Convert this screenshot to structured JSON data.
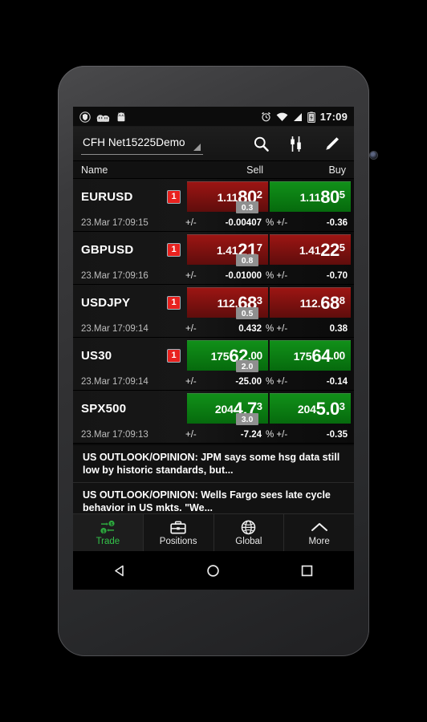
{
  "status_bar": {
    "left_icons": [
      "shield-icon",
      "cloud-sync-icon",
      "android-robot-icon"
    ],
    "right_icons": [
      "alarm-icon",
      "wifi-icon",
      "signal-icon",
      "battery-charging-icon"
    ],
    "time": "17:09"
  },
  "toolbar": {
    "account": "CFH Net15225Demo",
    "actions": [
      {
        "name": "search-icon",
        "label": "Search"
      },
      {
        "name": "chart-icon",
        "label": "Charts"
      },
      {
        "name": "edit-icon",
        "label": "Edit"
      }
    ]
  },
  "quote_header": {
    "name": "Name",
    "sell": "Sell",
    "buy": "Buy"
  },
  "quotes": [
    {
      "symbol": "EURUSD",
      "badge": "1",
      "time": "23.Mar 17:09:15",
      "sell": {
        "pre": "1.11",
        "big": "80",
        "post": "2",
        "post_kind": "sup",
        "color": "red"
      },
      "buy": {
        "pre": "1.11",
        "big": "80",
        "post": "5",
        "post_kind": "sup",
        "color": "green"
      },
      "spread": "0.3",
      "change_label": "+/-",
      "change": "-0.00407",
      "pct_label": "% +/-",
      "pct": "-0.36"
    },
    {
      "symbol": "GBPUSD",
      "badge": "1",
      "time": "23.Mar 17:09:16",
      "sell": {
        "pre": "1.41",
        "big": "21",
        "post": "7",
        "post_kind": "sup",
        "color": "red"
      },
      "buy": {
        "pre": "1.41",
        "big": "22",
        "post": "5",
        "post_kind": "sup",
        "color": "red"
      },
      "spread": "0.8",
      "change_label": "+/-",
      "change": "-0.01000",
      "pct_label": "% +/-",
      "pct": "-0.70"
    },
    {
      "symbol": "USDJPY",
      "badge": "1",
      "time": "23.Mar 17:09:14",
      "sell": {
        "pre": "112.",
        "big": "68",
        "post": "3",
        "post_kind": "sup",
        "color": "red"
      },
      "buy": {
        "pre": "112.",
        "big": "68",
        "post": "8",
        "post_kind": "sup",
        "color": "red"
      },
      "spread": "0.5",
      "change_label": "+/-",
      "change": "0.432",
      "pct_label": "% +/-",
      "pct": "0.38"
    },
    {
      "symbol": "US30",
      "badge": "1",
      "time": "23.Mar 17:09:14",
      "sell": {
        "pre": "175",
        "big": "62",
        "post": ".00",
        "post_kind": "dec",
        "color": "green"
      },
      "buy": {
        "pre": "175",
        "big": "64",
        "post": ".00",
        "post_kind": "dec",
        "color": "green"
      },
      "spread": "2.0",
      "change_label": "+/-",
      "change": "-25.00",
      "pct_label": "% +/-",
      "pct": "-0.14"
    },
    {
      "symbol": "SPX500",
      "badge": "",
      "time": "23.Mar 17:09:13",
      "sell": {
        "pre": "204",
        "big": "4.7",
        "post": "3",
        "post_kind": "sup",
        "color": "green"
      },
      "buy": {
        "pre": "204",
        "big": "5.0",
        "post": "3",
        "post_kind": "sup",
        "color": "green"
      },
      "spread": "3.0",
      "change_label": "+/-",
      "change": "-7.24",
      "pct_label": "% +/-",
      "pct": "-0.35"
    }
  ],
  "news": [
    "US OUTLOOK/OPINION: JPM says some hsg data still low by historic standards, but...",
    "US OUTLOOK/OPINION: Wells Fargo sees late cycle behavior in US mkts. \"We..."
  ],
  "tabs": [
    {
      "label": "Trade",
      "icon": "currency-exchange-icon",
      "active": true
    },
    {
      "label": "Positions",
      "icon": "briefcase-icon",
      "active": false
    },
    {
      "label": "Global",
      "icon": "globe-icon",
      "active": false
    },
    {
      "label": "More",
      "icon": "chevron-up-icon",
      "active": false
    }
  ],
  "nav_bar": [
    {
      "name": "back-button",
      "icon": "triangle-left-icon"
    },
    {
      "name": "home-button",
      "icon": "circle-icon"
    },
    {
      "name": "recents-button",
      "icon": "square-icon"
    }
  ],
  "colors": {
    "sell_red": "#9c1513",
    "buy_green": "#119019",
    "badge_red": "#e8221f",
    "accent_green": "#34c24a",
    "spread_gray": "#8f8f8f"
  }
}
